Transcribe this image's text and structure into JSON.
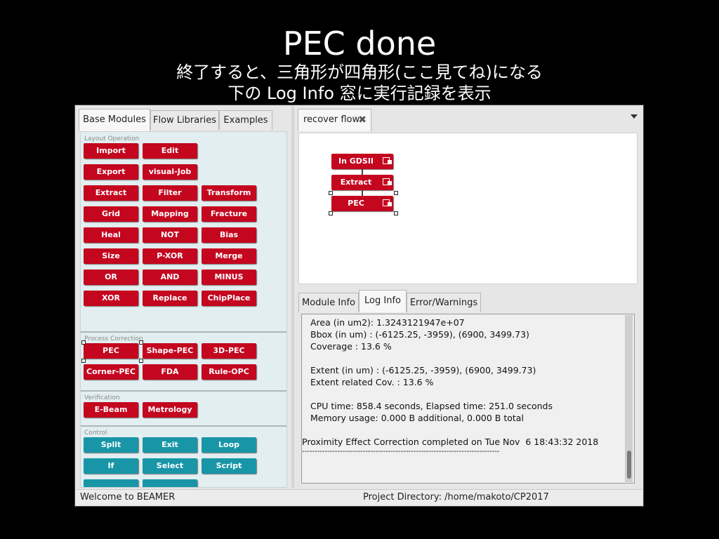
{
  "slide": {
    "title": "PEC done",
    "subtitle_line1": "終了すると、三角形が四角形(ここ見てね)になる",
    "subtitle_line2": "下の Log Info 窓に実行記録を表示"
  },
  "left_tabs": [
    "Base Modules",
    "Flow Libraries",
    "Examples"
  ],
  "palette": {
    "layout_operation": {
      "label": "Layout Operation",
      "buttons": [
        "Import",
        "Edit",
        "Export",
        "visual-Job",
        "Extract",
        "Filter",
        "Transform",
        "Grid",
        "Mapping",
        "Fracture",
        "Heal",
        "NOT",
        "Bias",
        "Size",
        "P-XOR",
        "Merge",
        "OR",
        "AND",
        "MINUS",
        "XOR",
        "Replace",
        "ChipPlace"
      ]
    },
    "process_correction": {
      "label": "Process Correction",
      "buttons": [
        "PEC",
        "Shape-PEC",
        "3D-PEC",
        "Corner-PEC",
        "FDA",
        "Rule-OPC"
      ]
    },
    "verification": {
      "label": "Verification",
      "buttons": [
        "E-Beam",
        "Metrology"
      ]
    },
    "control": {
      "label": "Control",
      "buttons": [
        "Split",
        "Exit",
        "Loop",
        "If",
        "Select",
        "Script"
      ]
    }
  },
  "flow": {
    "tab_label": "recover flow",
    "nodes": [
      "In GDSII",
      "Extract",
      "PEC"
    ]
  },
  "info_tabs": [
    "Module Info",
    "Log Info",
    "Error/Warnings"
  ],
  "log": {
    "area": "Area (in um2): 1.3243121947e+07",
    "bbox": "Bbox (in um) : (-6125.25, -3959), (6900, 3499.73)",
    "coverage": "Coverage : 13.6 %",
    "extent": "Extent (in um) : (-6125.25, -3959), (6900, 3499.73)",
    "extent_cov": "Extent related Cov. : 13.6 %",
    "cpu": "CPU time: 858.4 seconds, Elapsed time: 251.0 seconds",
    "memory": "Memory usage: 0.000 B additional, 0.000 B total",
    "completed": "Proximity Effect Correction completed on Tue Nov  6 18:43:32 2018",
    "divider": "------------------------------------------------------------------------------"
  },
  "status": {
    "left": "Welcome to BEAMER",
    "right": "Project Directory: /home/makoto/CP2017"
  }
}
